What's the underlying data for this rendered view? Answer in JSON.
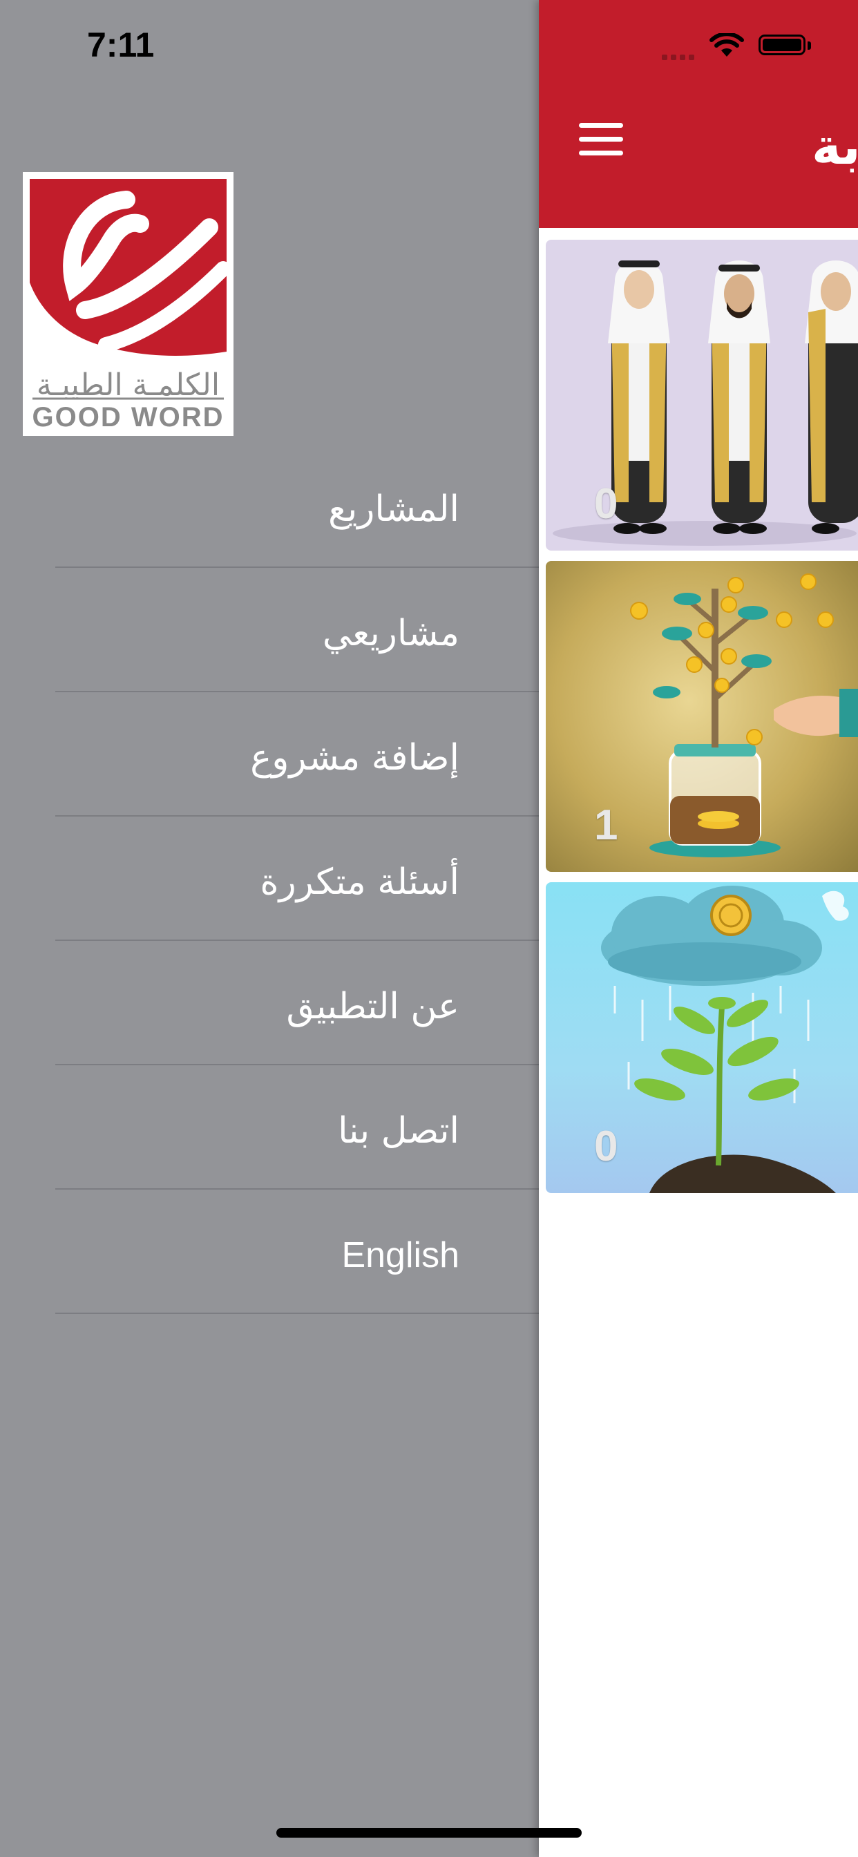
{
  "status_bar": {
    "time": "7:11"
  },
  "logo": {
    "arabic_text": "الكلمـة الطيبـة",
    "english_text": "GOOD WORD",
    "brand_color": "#c21d2b"
  },
  "drawer": {
    "items": [
      {
        "label": "المشاريع"
      },
      {
        "label": "مشاريعي"
      },
      {
        "label": "إضافة مشروع"
      },
      {
        "label": "أسئلة متكررة"
      },
      {
        "label": "عن التطبيق"
      },
      {
        "label": "اتصل بنا"
      },
      {
        "label": "English"
      }
    ]
  },
  "header": {
    "title": "بة",
    "menu_icon": "hamburger-icon",
    "background": "#c21d2b"
  },
  "projects": [
    {
      "count": "0",
      "image": "men-in-bisht-illustration"
    },
    {
      "count": "1",
      "image": "money-tree-jar-illustration"
    },
    {
      "count": "0",
      "image": "plant-cloud-coin-illustration"
    }
  ]
}
